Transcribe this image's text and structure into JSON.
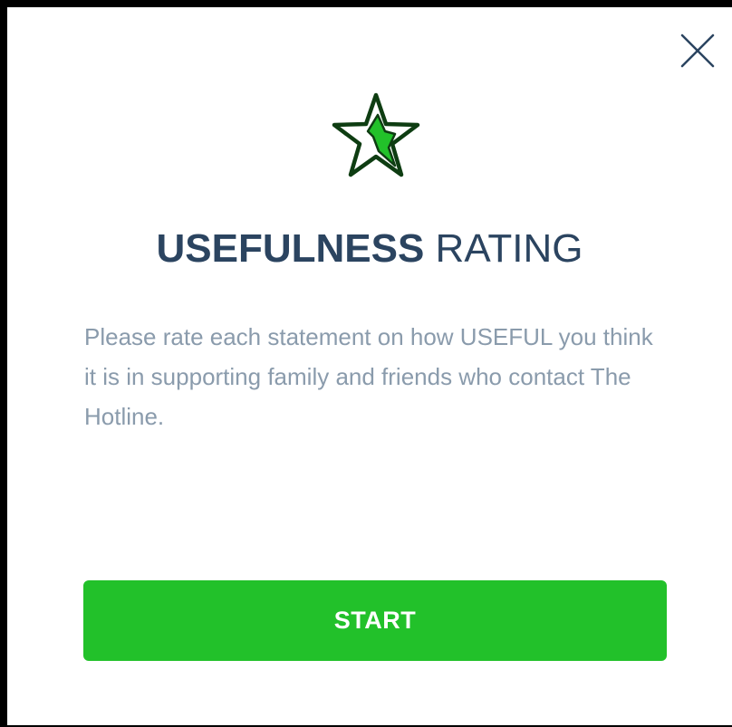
{
  "modal": {
    "close_icon": "close-icon",
    "star_icon": "star-icon",
    "title_strong": "USEFULNESS",
    "title_light": "RATING",
    "description": "Please rate each statement on how USEFUL you think it is in supporting family and friends who contact The Hotline.",
    "start_label": "START"
  },
  "colors": {
    "accent_green": "#22c12a",
    "star_outline": "#0e3d12",
    "title_text": "#2b4460",
    "body_text": "#8a9bac"
  }
}
